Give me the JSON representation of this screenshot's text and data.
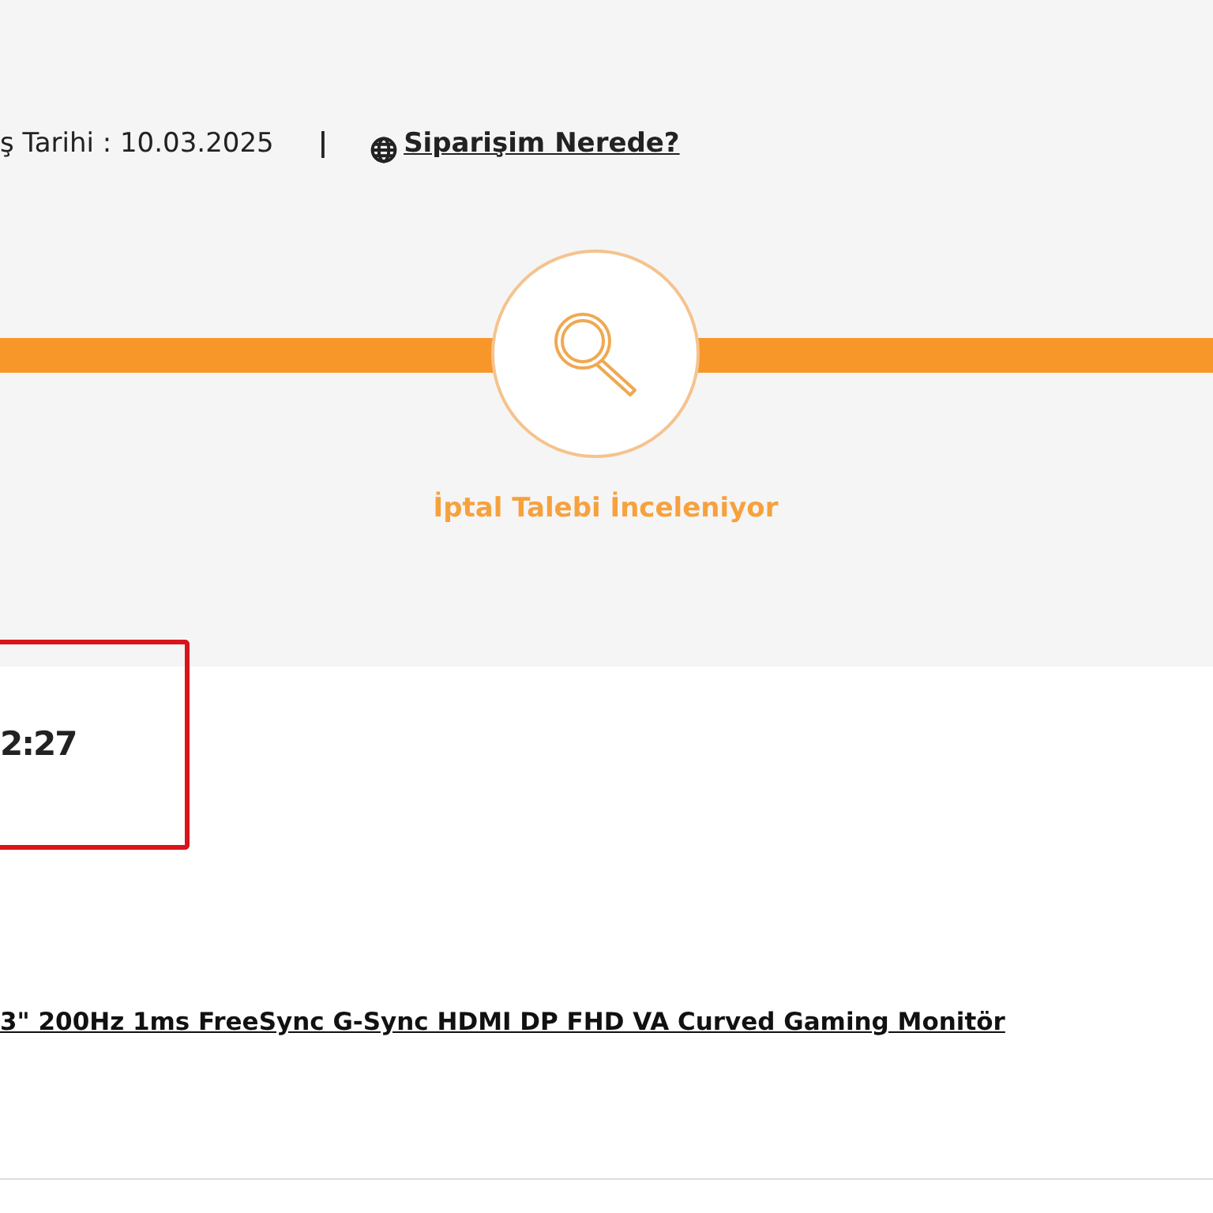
{
  "header": {
    "order_date": "ş Tarihi : 10.03.2025",
    "separator": "|",
    "track_link": "Siparişim Nerede?"
  },
  "progress": {
    "step_label": "İptal Talebi İnceleniyor"
  },
  "highlight": {
    "time": "2:27"
  },
  "product": {
    "link": "3\" 200Hz 1ms FreeSync G-Sync HDMI DP FHD VA Curved Gaming Monitör"
  }
}
